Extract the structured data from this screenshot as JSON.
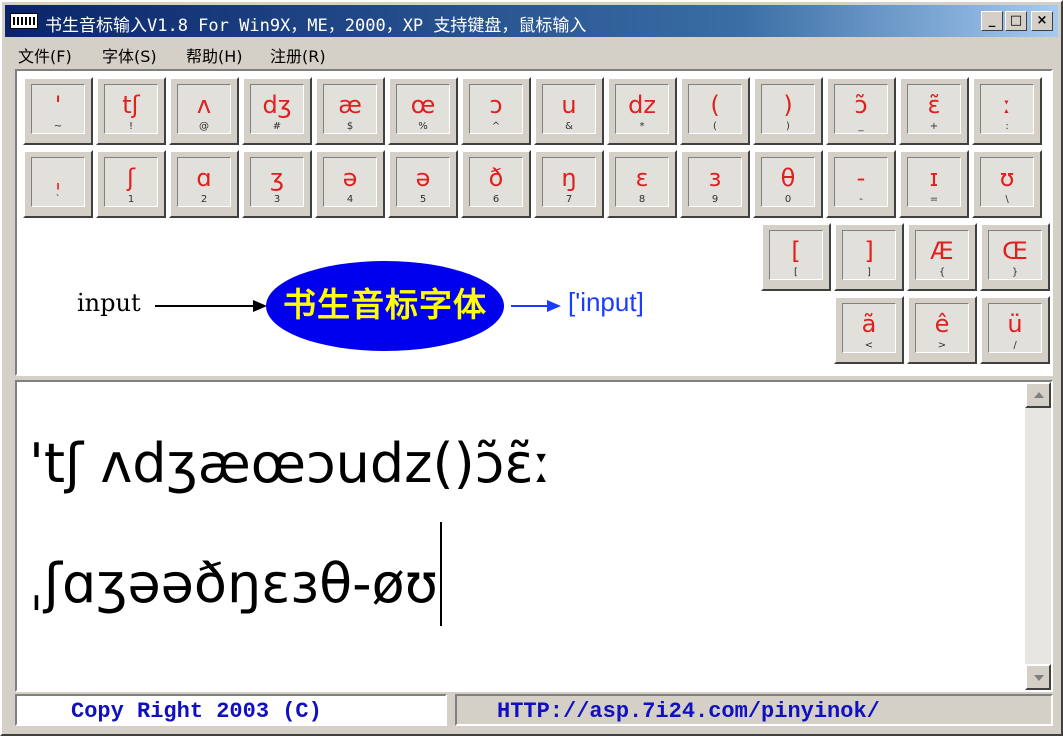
{
  "window": {
    "title": "书生音标输入V1.8 For Win9X，ME，2000，XP 支持键盘，鼠标输入",
    "minimize": "_",
    "maximize": "□",
    "close": "×"
  },
  "menu": [
    {
      "label": "文件(F)"
    },
    {
      "label": "字体(S)"
    },
    {
      "label": "帮助(H)"
    },
    {
      "label": "注册(R)"
    }
  ],
  "keys_row1": [
    {
      "sym": "'",
      "sub": "~"
    },
    {
      "sym": "tʃ",
      "sub": "!"
    },
    {
      "sym": "ʌ",
      "sub": "@"
    },
    {
      "sym": "dʒ",
      "sub": "#"
    },
    {
      "sym": "æ",
      "sub": "$"
    },
    {
      "sym": "œ",
      "sub": "%"
    },
    {
      "sym": "ɔ",
      "sub": "^"
    },
    {
      "sym": "u",
      "sub": "&"
    },
    {
      "sym": "dz",
      "sub": "*"
    },
    {
      "sym": "(",
      "sub": "("
    },
    {
      "sym": ")",
      "sub": ")"
    },
    {
      "sym": "ɔ̃",
      "sub": "_"
    },
    {
      "sym": "ɛ̃",
      "sub": "+"
    },
    {
      "sym": "ː",
      "sub": ":"
    }
  ],
  "keys_row2": [
    {
      "sym": "ˌ",
      "sub": "`"
    },
    {
      "sym": "ʃ",
      "sub": "1"
    },
    {
      "sym": "ɑ",
      "sub": "2"
    },
    {
      "sym": "ʒ",
      "sub": "3"
    },
    {
      "sym": "ə",
      "sub": "4"
    },
    {
      "sym": "ə",
      "sub": "5"
    },
    {
      "sym": "ð",
      "sub": "6"
    },
    {
      "sym": "ŋ",
      "sub": "7"
    },
    {
      "sym": "ɛ",
      "sub": "8"
    },
    {
      "sym": "з",
      "sub": "9"
    },
    {
      "sym": "θ",
      "sub": "0"
    },
    {
      "sym": "-",
      "sub": "-"
    },
    {
      "sym": "ɪ",
      "sub": "="
    },
    {
      "sym": "ʊ",
      "sub": "\\"
    }
  ],
  "keys_row3": [
    {
      "sym": "[",
      "sub": "["
    },
    {
      "sym": "]",
      "sub": "]"
    },
    {
      "sym": "Æ",
      "sub": "{"
    },
    {
      "sym": "Œ",
      "sub": "}"
    }
  ],
  "keys_row4": [
    {
      "sym": "ã",
      "sub": "<"
    },
    {
      "sym": "ê",
      "sub": ">"
    },
    {
      "sym": "ü",
      "sub": "/"
    }
  ],
  "diagram": {
    "input": "input",
    "font_name": "书生音标字体",
    "output": "['input]"
  },
  "editor": {
    "line1": "'tʃ ʌdʒæœɔudz()ɔ̃ɛ̃ː",
    "line2": "ˌʃɑʒəəðŋɛзθ-øʊ"
  },
  "status": {
    "left": "Copy Right 2003 (C)",
    "right": "HTTP://asp.7i24.com/pinyinok/"
  }
}
